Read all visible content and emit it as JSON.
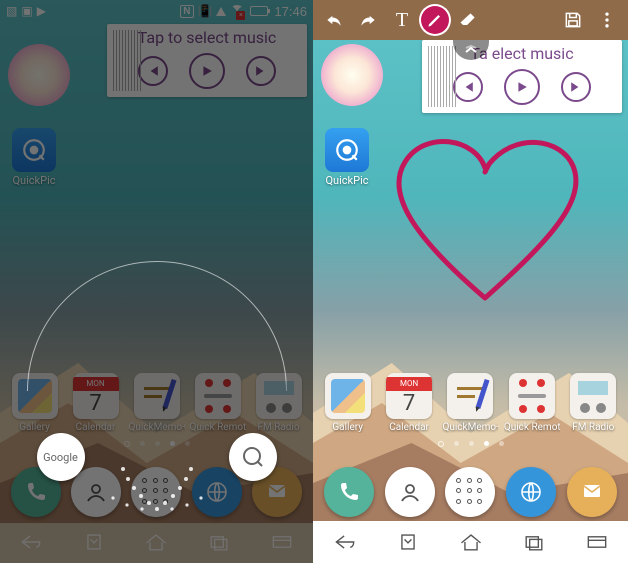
{
  "status": {
    "nfc": "N",
    "wifi_mark": "×",
    "time": "17:46"
  },
  "music": {
    "title": "Tap to select music",
    "title_obscured": "Ta       elect music"
  },
  "quickpic": {
    "label": "QuickPic"
  },
  "apps": [
    {
      "name": "Gallery"
    },
    {
      "name": "Calendar",
      "month": "MON",
      "day": "7"
    },
    {
      "name": "QuickMemo+"
    },
    {
      "name": "Quick Remote"
    },
    {
      "name": "FM Radio"
    }
  ],
  "floating": {
    "google_label": "Google"
  },
  "icons": {
    "undo": "undo",
    "redo": "redo",
    "text": "T",
    "pen": "pen",
    "eraser": "eraser",
    "save": "save",
    "more": "more"
  }
}
